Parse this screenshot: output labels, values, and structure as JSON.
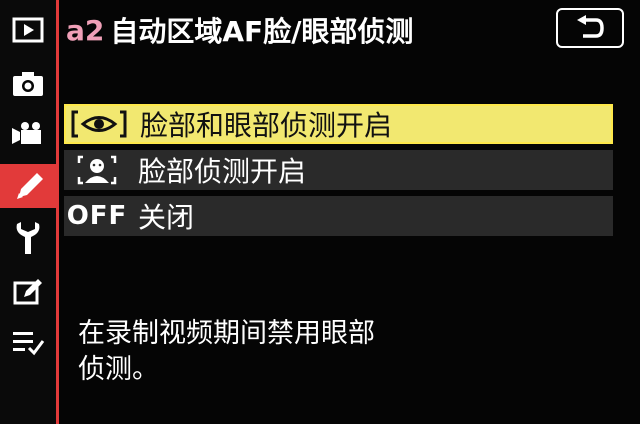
{
  "header": {
    "code": "a2",
    "title": "自动区域AF脸/眼部侦测"
  },
  "sidebar": {
    "items": [
      {
        "name": "playback-icon"
      },
      {
        "name": "camera-icon"
      },
      {
        "name": "movie-icon"
      },
      {
        "name": "pencil-icon"
      },
      {
        "name": "wrench-icon"
      },
      {
        "name": "retouch-icon"
      },
      {
        "name": "my-menu-icon"
      }
    ],
    "active_index": 3
  },
  "options": [
    {
      "label": "脸部和眼部侦测开启",
      "icon": "eye-detection-icon",
      "selected": true
    },
    {
      "label": "脸部侦测开启",
      "icon": "face-detection-icon",
      "selected": false
    },
    {
      "label": "关闭",
      "icon_text": "OFF",
      "selected": false
    }
  ],
  "help": {
    "line1": "在录制视频期间禁用眼部",
    "line2": "侦测。"
  },
  "colors": {
    "accent": "#e23a3a",
    "selected_bg": "#f2e870",
    "option_bg": "#2a2a2a",
    "code_color": "#f0a0b8"
  }
}
